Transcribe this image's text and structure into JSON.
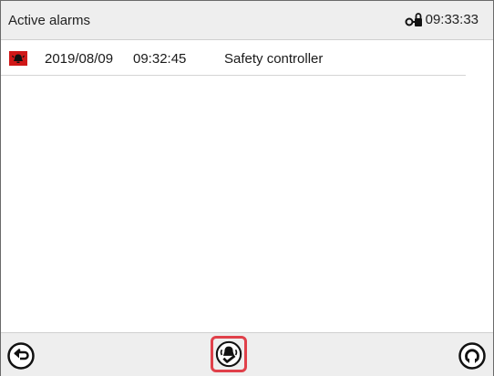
{
  "header": {
    "title": "Active alarms",
    "clock": "09:33:33",
    "lock_icon": "key-lock-icon"
  },
  "alarms": [
    {
      "icon": "alarm-bell-icon",
      "date": "2019/08/09",
      "time": "09:32:45",
      "text": "Safety controller"
    }
  ],
  "footer": {
    "back_icon": "back-arrow-icon",
    "mute_icon": "mute-alarm-icon",
    "refresh_icon": "refresh-icon"
  },
  "colors": {
    "header_bg": "#eeeeee",
    "alarm_red": "#d01818",
    "highlight": "#e0404a"
  }
}
